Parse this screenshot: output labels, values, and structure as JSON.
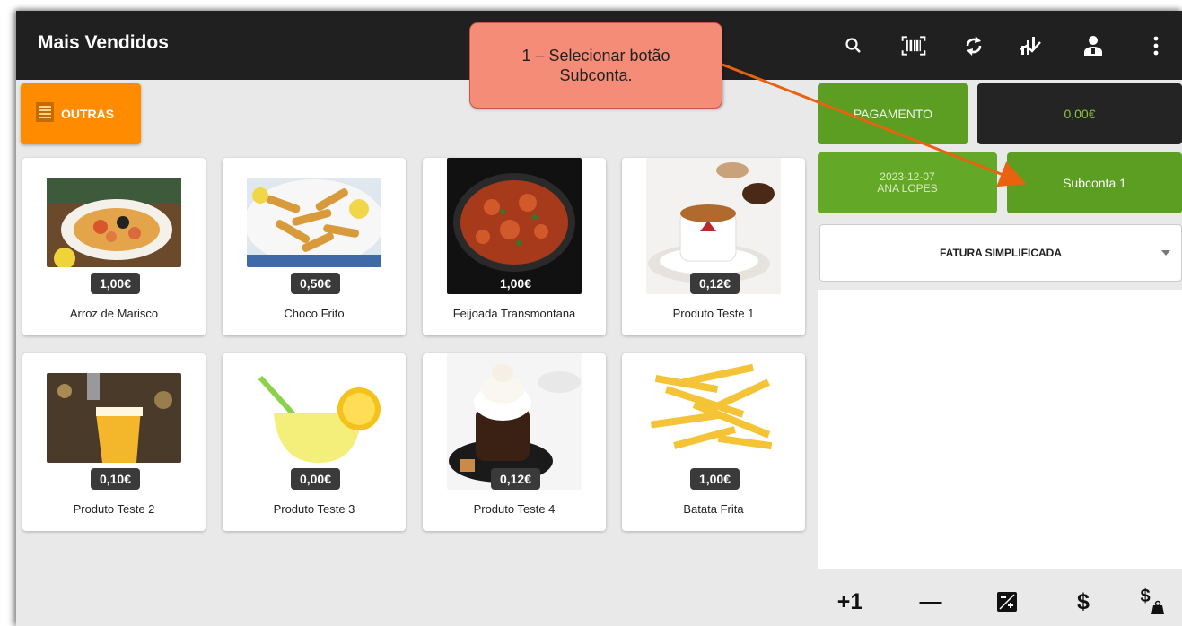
{
  "topbar": {
    "title": "Mais Vendidos",
    "icons": [
      "search-icon",
      "barcode-icon",
      "sync-icon",
      "chart-icon",
      "user-icon",
      "more-vert-icon"
    ]
  },
  "category": {
    "label": "OUTRAS",
    "icon": "list-icon",
    "color": "#ff8c00"
  },
  "products": [
    {
      "name": "Arroz de Marisco",
      "price": "1,00€"
    },
    {
      "name": "Choco Frito",
      "price": "0,50€"
    },
    {
      "name": "Feijoada Transmontana",
      "price": "1,00€"
    },
    {
      "name": "Produto Teste 1",
      "price": "0,12€"
    },
    {
      "name": "Produto Teste 2",
      "price": "0,10€"
    },
    {
      "name": "Produto Teste 3",
      "price": "0,00€"
    },
    {
      "name": "Produto Teste 4",
      "price": "0,12€"
    },
    {
      "name": "Batata Frita",
      "price": "1,00€"
    }
  ],
  "panel": {
    "payment_label": "PAGAMENTO",
    "total": "0,00€",
    "date": "2023-12-07",
    "operator": "ANA LOPES",
    "subaccount_label": "Subconta 1",
    "document_type": "FATURA SIMPLIFICADA"
  },
  "bottom_actions": {
    "plus_one": "+1",
    "minus": "—",
    "currency": "$"
  },
  "callout": {
    "text": "1 – Selecionar botão Subconta."
  },
  "colors": {
    "green": "#5c9e22",
    "dark": "#202020",
    "orange": "#ff8c00",
    "callout": "#f58c77",
    "arrow": "#e8620f"
  }
}
